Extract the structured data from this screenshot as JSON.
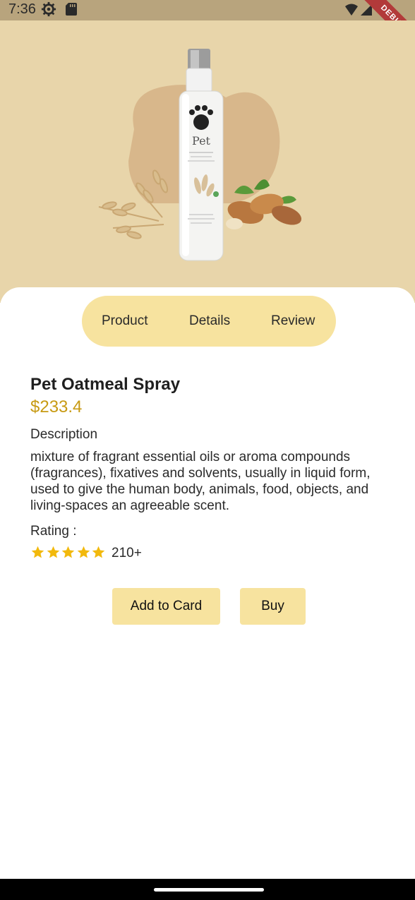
{
  "status_bar": {
    "time": "7:36"
  },
  "debug_banner": {
    "label": "DEBUG"
  },
  "hero": {
    "image": "pet-oatmeal-spray-bottle",
    "background_color": "#e8d5aa"
  },
  "tabs": [
    {
      "label": "Product"
    },
    {
      "label": "Details"
    },
    {
      "label": "Review"
    }
  ],
  "product": {
    "title": "Pet Oatmeal Spray",
    "price": "$233.4",
    "description_label": "Description",
    "description": "mixture of fragrant essential oils or aroma compounds (fragrances), fixatives and solvents, usually in liquid form, used to give the human body, animals, food, objects, and living-spaces an agreeable scent.",
    "rating_label": "Rating :",
    "rating_stars": 5,
    "rating_count": "210+"
  },
  "actions": {
    "add_label": "Add to Card",
    "buy_label": "Buy"
  },
  "colors": {
    "accent": "#f7e39f",
    "price": "#c79a13",
    "star": "#f2b90c"
  }
}
